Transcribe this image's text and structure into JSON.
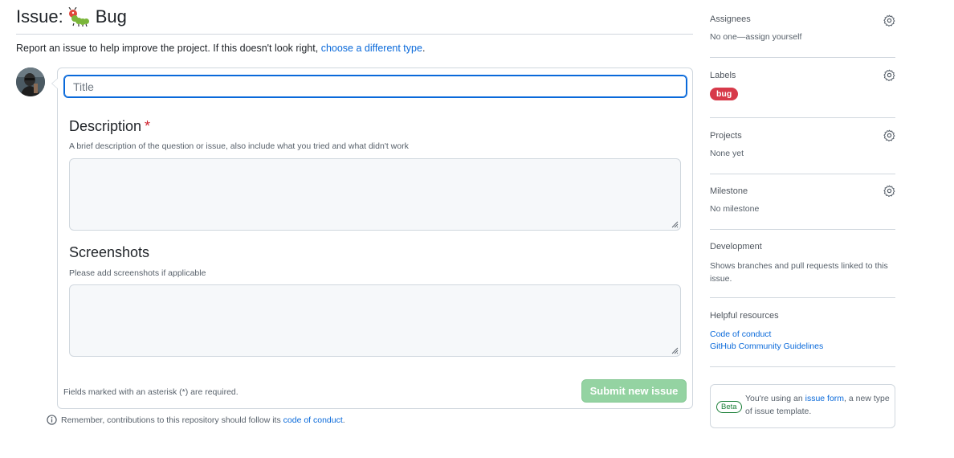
{
  "page": {
    "title_prefix": "Issue:",
    "title_name": "Bug",
    "report_text": "Report an issue to help improve the project. If this doesn't look right,",
    "report_link": "choose a different type",
    "report_end": "."
  },
  "form": {
    "title_placeholder": "Title",
    "description": {
      "label": "Description",
      "required_mark": "*",
      "help": "A brief description of the question or issue, also include what you tried and what didn't work",
      "value": ""
    },
    "screenshots": {
      "label": "Screenshots",
      "help": "Please add screenshots if applicable",
      "value": ""
    },
    "footer_note": "Fields marked with an asterisk (*) are required.",
    "submit_label": "Submit new issue",
    "remember_text": "Remember, contributions to this repository should follow its",
    "remember_link": "code of conduct",
    "remember_end": "."
  },
  "sidebar": {
    "assignees": {
      "heading": "Assignees",
      "value": "No one—assign yourself"
    },
    "labels": {
      "heading": "Labels",
      "items": [
        {
          "name": "bug",
          "color": "#d73a4a"
        }
      ]
    },
    "projects": {
      "heading": "Projects",
      "value": "None yet"
    },
    "milestone": {
      "heading": "Milestone",
      "value": "No milestone"
    },
    "development": {
      "heading": "Development",
      "value": "Shows branches and pull requests linked to this issue."
    },
    "resources": {
      "heading": "Helpful resources",
      "links": [
        "Code of conduct",
        "GitHub Community Guidelines"
      ]
    },
    "beta": {
      "badge": "Beta",
      "text_before": "You're using an",
      "link": "issue form",
      "text_after": ", a new type of issue template."
    }
  },
  "colors": {
    "accent": "#0969da",
    "label_bug": "#d73a4a",
    "submit_disabled": "#94d3a2",
    "required": "#cf222e",
    "beta_green": "#1a7f37"
  },
  "icons": {
    "title_emoji": "caterpillar-bug-icon",
    "gear": "gear-icon",
    "info": "info-icon",
    "resize": "resize-grip-icon"
  }
}
